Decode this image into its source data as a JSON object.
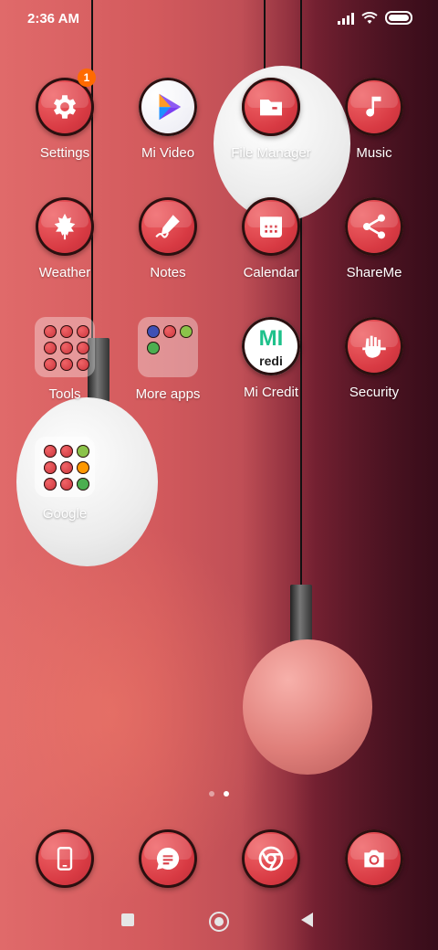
{
  "status": {
    "time": "2:36 AM"
  },
  "apps": [
    {
      "name": "Settings",
      "icon": "gear-icon",
      "badge": "1"
    },
    {
      "name": "Mi Video",
      "icon": "play-icon"
    },
    {
      "name": "File Manager",
      "icon": "folder-icon"
    },
    {
      "name": "Music",
      "icon": "music-note-icon"
    },
    {
      "name": "Weather",
      "icon": "leaf-icon"
    },
    {
      "name": "Notes",
      "icon": "pen-icon"
    },
    {
      "name": "Calendar",
      "icon": "calendar-icon"
    },
    {
      "name": "ShareMe",
      "icon": "share-icon"
    },
    {
      "name": "Tools",
      "icon": "folder-grid-icon"
    },
    {
      "name": "More apps",
      "icon": "folder-grid-icon"
    },
    {
      "name": "Mi Credit",
      "icon": "mi-credit-icon",
      "icon_text": "MI",
      "icon_subtext": "redi"
    },
    {
      "name": "Security",
      "icon": "shield-hand-icon"
    },
    {
      "name": "Google",
      "icon": "folder-grid-icon"
    }
  ],
  "dock": [
    {
      "name": "Phone",
      "icon": "phone-icon"
    },
    {
      "name": "Messages",
      "icon": "message-icon"
    },
    {
      "name": "Chrome",
      "icon": "chrome-icon"
    },
    {
      "name": "Camera",
      "icon": "camera-icon"
    }
  ],
  "pages": {
    "count": 2,
    "active": 2
  },
  "colors": {
    "icon_red": "#d83a43",
    "badge": "#ff6a00"
  }
}
